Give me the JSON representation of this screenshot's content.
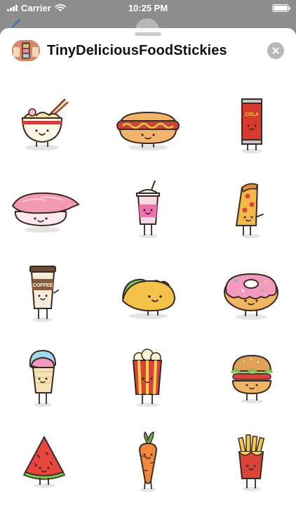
{
  "status_bar": {
    "carrier": "Carrier",
    "time": "10:25 PM",
    "battery_level": 1.0
  },
  "sheet": {
    "title": "TinyDeliciousFoodStickies",
    "close_icon": "close-x-icon"
  },
  "stickers": [
    {
      "name": "ramen",
      "icon": "ramen-bowl-sticker"
    },
    {
      "name": "hotdog",
      "icon": "hotdog-sticker"
    },
    {
      "name": "cola",
      "icon": "cola-can-sticker",
      "label": "COLA"
    },
    {
      "name": "sushi",
      "icon": "sushi-sticker"
    },
    {
      "name": "milkshake",
      "icon": "milkshake-sticker"
    },
    {
      "name": "pizza",
      "icon": "pizza-slice-sticker"
    },
    {
      "name": "coffee",
      "icon": "coffee-cup-sticker",
      "label": "COFFEE"
    },
    {
      "name": "taco",
      "icon": "taco-sticker"
    },
    {
      "name": "donut",
      "icon": "donut-sticker"
    },
    {
      "name": "ice-cream",
      "icon": "ice-cream-sticker"
    },
    {
      "name": "popcorn",
      "icon": "popcorn-sticker"
    },
    {
      "name": "burger",
      "icon": "burger-sticker"
    },
    {
      "name": "watermelon",
      "icon": "watermelon-sticker"
    },
    {
      "name": "carrot",
      "icon": "carrot-sticker"
    },
    {
      "name": "fries",
      "icon": "fries-sticker"
    }
  ],
  "colors": {
    "sheet_bg": "#ffffff",
    "dim_bg": "#8d8d8d",
    "close_bg": "#b7b7bb",
    "outline": "#3a2a22"
  }
}
